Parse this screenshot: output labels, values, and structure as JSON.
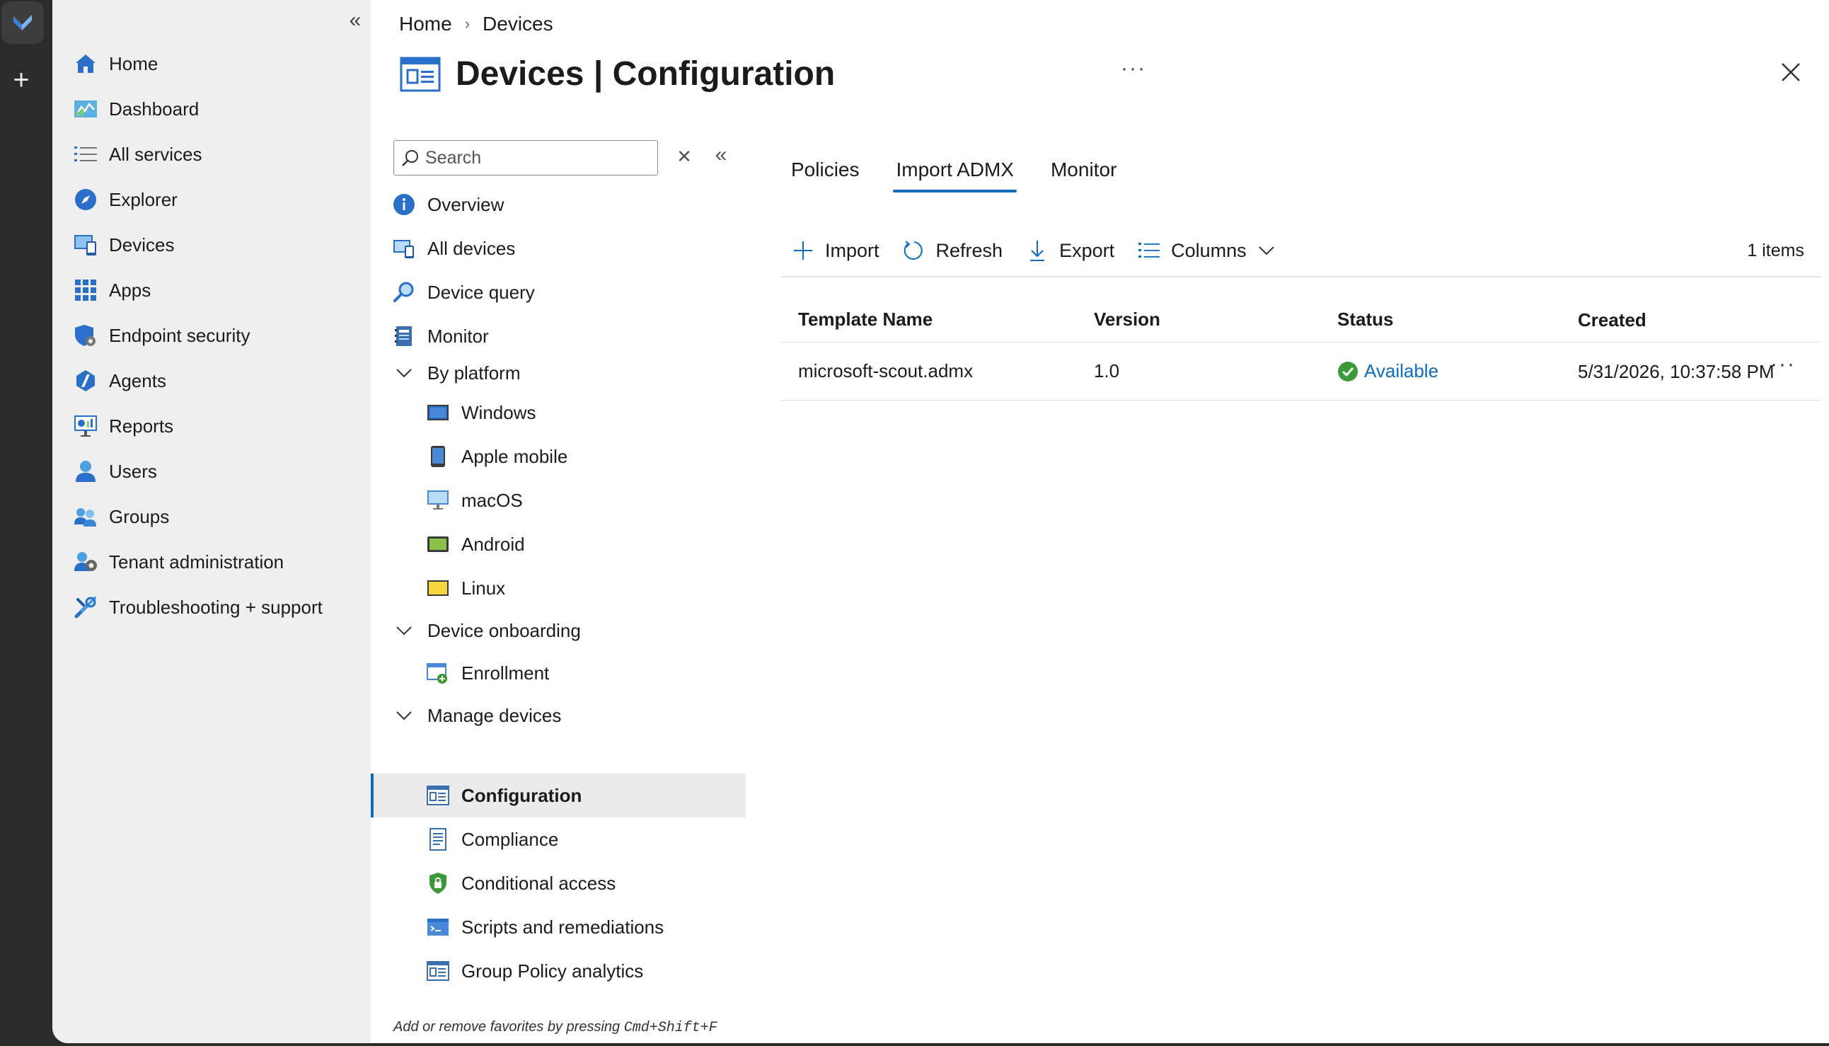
{
  "global_nav": {
    "items": [
      {
        "label": "Home",
        "icon": "home-icon"
      },
      {
        "label": "Dashboard",
        "icon": "dashboard-icon"
      },
      {
        "label": "All services",
        "icon": "all-services-icon"
      },
      {
        "label": "Explorer",
        "icon": "explorer-icon"
      },
      {
        "label": "Devices",
        "icon": "devices-icon"
      },
      {
        "label": "Apps",
        "icon": "apps-icon"
      },
      {
        "label": "Endpoint security",
        "icon": "endpoint-security-icon"
      },
      {
        "label": "Agents",
        "icon": "agents-icon"
      },
      {
        "label": "Reports",
        "icon": "reports-icon"
      },
      {
        "label": "Users",
        "icon": "users-icon"
      },
      {
        "label": "Groups",
        "icon": "groups-icon"
      },
      {
        "label": "Tenant administration",
        "icon": "tenant-admin-icon"
      },
      {
        "label": "Troubleshooting + support",
        "icon": "troubleshooting-icon"
      }
    ]
  },
  "breadcrumb": {
    "home": "Home",
    "separator": "›",
    "current": "Devices"
  },
  "header": {
    "title_bold": "Devices",
    "title_rest": " | Configuration",
    "more": "···"
  },
  "resource_menu": {
    "search_placeholder": "Search",
    "items": {
      "overview": "Overview",
      "all_devices": "All devices",
      "device_query": "Device query",
      "monitor": "Monitor",
      "by_platform": "By platform",
      "windows": "Windows",
      "apple_mobile": "Apple mobile",
      "macos": "macOS",
      "android": "Android",
      "linux": "Linux",
      "device_onboarding": "Device onboarding",
      "enrollment": "Enrollment",
      "manage_devices": "Manage devices",
      "configuration": "Configuration",
      "compliance": "Compliance",
      "conditional_access": "Conditional access",
      "scripts": "Scripts and remediations",
      "gp_analytics": "Group Policy analytics"
    },
    "hint_prefix": "Add or remove favorites by pressing ",
    "hint_keys": "Cmd+Shift+F"
  },
  "tabs": [
    {
      "label": "Policies",
      "active": false
    },
    {
      "label": "Import ADMX",
      "active": true
    },
    {
      "label": "Monitor",
      "active": false
    }
  ],
  "toolbar": {
    "import": "Import",
    "refresh": "Refresh",
    "export": "Export",
    "columns": "Columns",
    "count": "1 items"
  },
  "grid": {
    "headers": {
      "name": "Template Name",
      "version": "Version",
      "status": "Status",
      "created": "Created"
    },
    "rows": [
      {
        "name": "microsoft-scout.admx",
        "version": "1.0",
        "status": "Available",
        "created": "5/31/2026, 10:37:58 PM",
        "more": "···"
      }
    ]
  },
  "colors": {
    "accent": "#0f6cbd",
    "success": "#3a9a3a",
    "nav_bg": "#efefef",
    "strip_bg": "#2b2b2b"
  }
}
